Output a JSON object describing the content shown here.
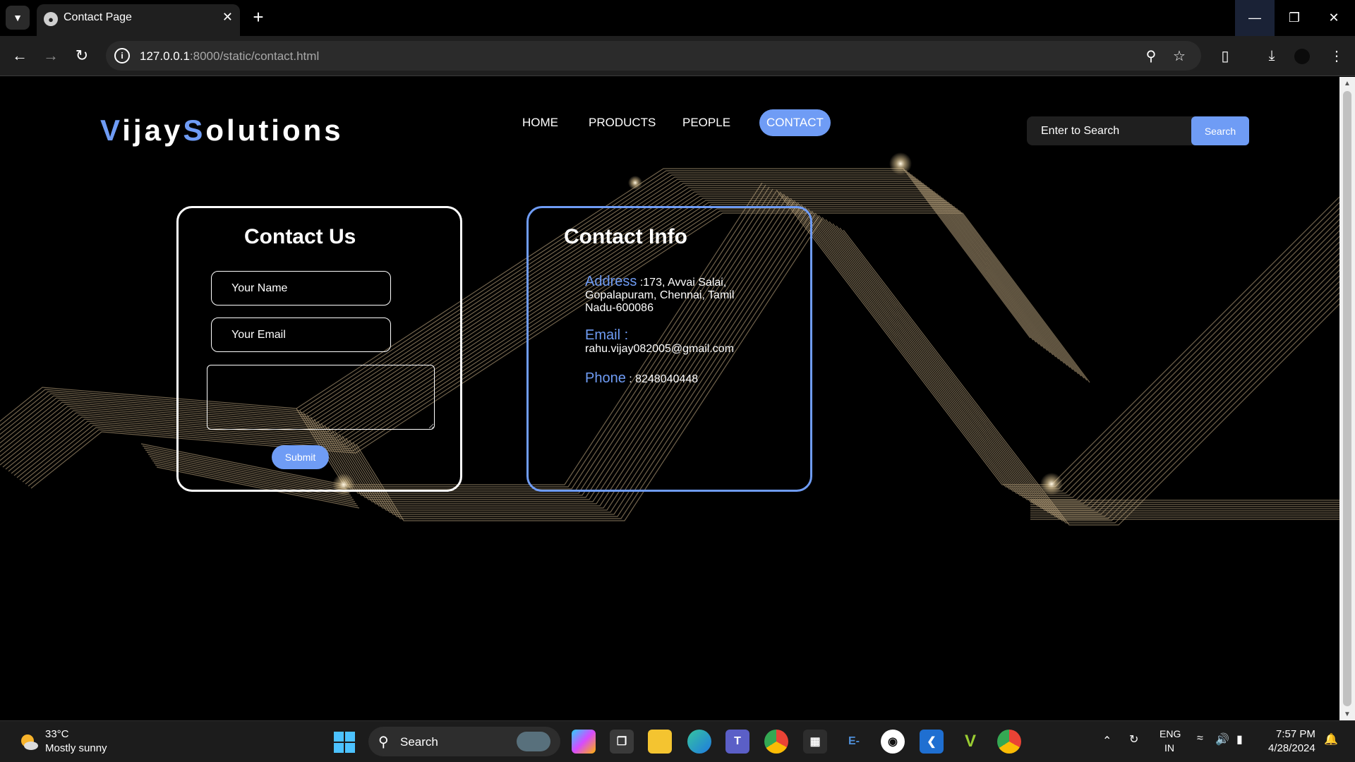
{
  "browser": {
    "tab_title": "Contact Page",
    "url_host": "127.0.0.1",
    "url_path": ":8000/static/contact.html"
  },
  "site": {
    "logo_first_letter": "V",
    "logo_mid": "ijay",
    "logo_second_letter": "S",
    "logo_end": "olutions",
    "nav": [
      {
        "label": "HOME"
      },
      {
        "label": "PRODUCTS"
      },
      {
        "label": "PEOPLE"
      },
      {
        "label": "CONTACT"
      }
    ],
    "search_placeholder": "Enter to Search",
    "search_button": "Search",
    "accent_color": "#6f9cf5"
  },
  "contact_form": {
    "title": "Contact Us",
    "name_placeholder": "Your Name",
    "email_placeholder": "Your Email",
    "submit_label": "Submit"
  },
  "contact_info": {
    "title": "Contact Info",
    "address_label": "Address",
    "address_value": " :173, Avvai Salai, Gopalapuram, Chennai, Tamil Nadu-600086",
    "email_label": "Email",
    "email_sep": " :",
    "email_value": "rahu.vijay082005@gmail.com",
    "phone_label": "Phone",
    "phone_value": " : 8248040448"
  },
  "taskbar": {
    "temperature": "33°C",
    "weather": "Mostly sunny",
    "search_label": "Search",
    "lang_top": "ENG",
    "lang_bottom": "IN",
    "time": "7:57 PM",
    "date": "4/28/2024"
  }
}
